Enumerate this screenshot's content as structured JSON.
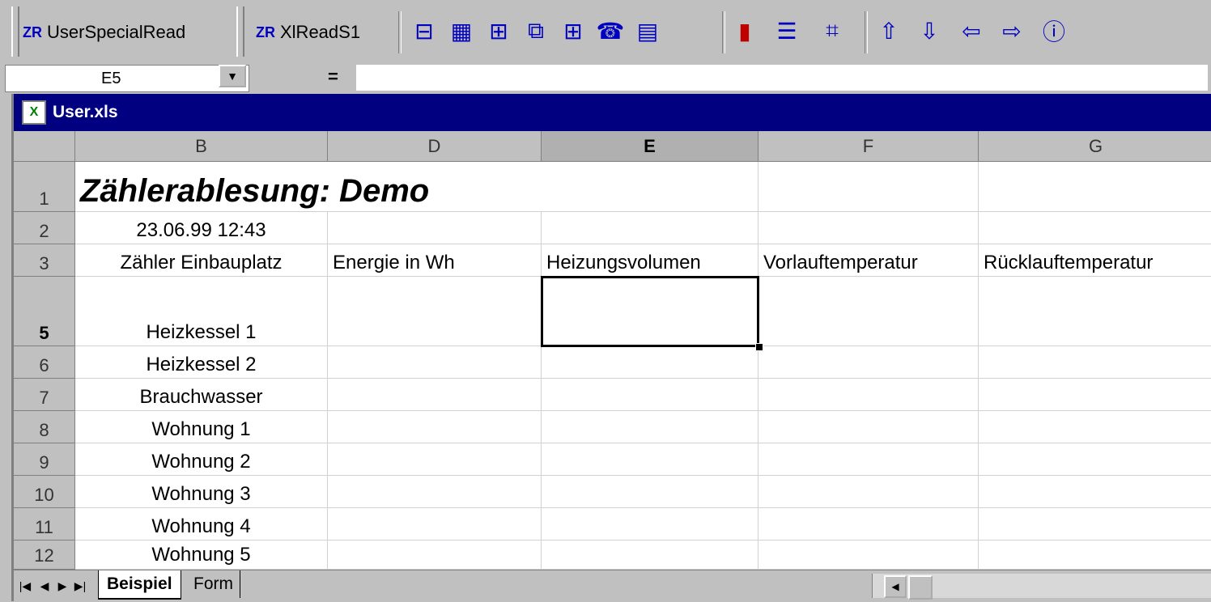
{
  "toolbar": {
    "buttons": [
      {
        "prefix": "ZR",
        "label": "UserSpecialRead"
      },
      {
        "prefix": "ZR",
        "label": "XlReadS1"
      }
    ],
    "icons": [
      {
        "name": "read-single-icon",
        "glyph": "⊟"
      },
      {
        "name": "read-grid-icon",
        "glyph": "▦"
      },
      {
        "name": "read-columns-icon",
        "glyph": "⊞"
      },
      {
        "name": "read-register-icon",
        "glyph": "⧉"
      },
      {
        "name": "read-multi-icon",
        "glyph": "⊞"
      },
      {
        "name": "read-phone-icon",
        "glyph": "☎"
      },
      {
        "name": "read-values-icon",
        "glyph": "▤"
      },
      {
        "name": "bar-chart-icon",
        "glyph": "▮"
      },
      {
        "name": "list-icon",
        "glyph": "☰"
      },
      {
        "name": "chart-icon",
        "glyph": "⌗"
      },
      {
        "name": "arrow-up-icon",
        "glyph": "⇧"
      },
      {
        "name": "arrow-down-icon",
        "glyph": "⇩"
      },
      {
        "name": "arrow-left-icon",
        "glyph": "⇦"
      },
      {
        "name": "arrow-right-icon",
        "glyph": "⇨"
      },
      {
        "name": "info-chart-icon",
        "glyph": "ⓘ"
      }
    ]
  },
  "formula_bar": {
    "name_box": "E5",
    "equals": "=",
    "formula": ""
  },
  "workbook": {
    "title": "User.xls"
  },
  "grid": {
    "columns": [
      "B",
      "D",
      "E",
      "F",
      "G"
    ],
    "rows": [
      "1",
      "2",
      "3",
      "5",
      "6",
      "7",
      "8",
      "9",
      "10",
      "11",
      "12"
    ],
    "title": "Zählerablesung: Demo",
    "timestamp": "23.06.99 12:43",
    "headers": [
      "Zähler Einbauplatz",
      "Energie in Wh",
      "Heizungsvolumen",
      "Vorlauftemperatur",
      "Rücklauftemperatur"
    ],
    "locations": [
      "Heizkessel 1",
      "Heizkessel 2",
      "Brauchwasser",
      "Wohnung 1",
      "Wohnung 2",
      "Wohnung 3",
      "Wohnung 4",
      "Wohnung 5"
    ]
  },
  "sheets": {
    "nav": [
      "|◀",
      "◀",
      "▶",
      "▶|"
    ],
    "tabs": [
      "Beispiel",
      "Form"
    ],
    "hscroll_left": "◀"
  },
  "colors": {
    "title_bar": "#000080",
    "toolbar_accent": "#0000c0",
    "chrome": "#c0c0c0"
  }
}
